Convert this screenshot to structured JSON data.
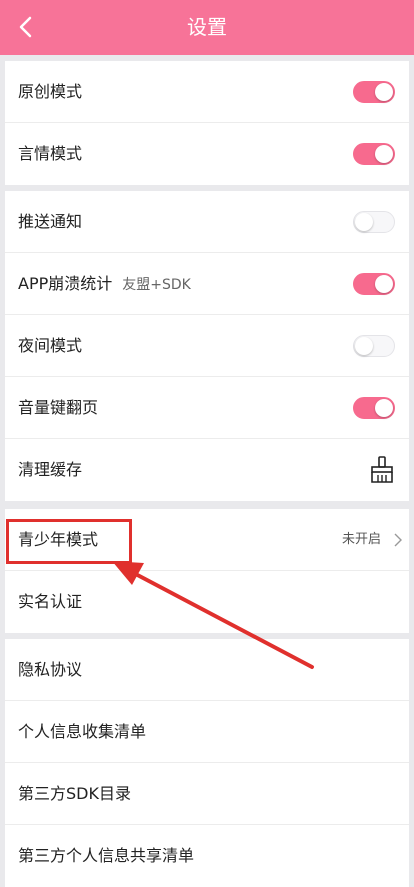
{
  "header": {
    "title": "设置",
    "back_icon": "chevron-left-icon"
  },
  "group1": [
    {
      "label": "原创模式",
      "toggle": true
    },
    {
      "label": "言情模式",
      "toggle": true
    }
  ],
  "group2": [
    {
      "label": "推送通知",
      "toggle": false
    },
    {
      "label": "APP崩溃统计",
      "sublabel": "友盟+SDK",
      "toggle": true
    },
    {
      "label": "夜间模式",
      "toggle": false
    },
    {
      "label": "音量键翻页",
      "toggle": true
    },
    {
      "label": "清理缓存",
      "icon": "broom-icon"
    }
  ],
  "group3": [
    {
      "label": "青少年模式",
      "status": "未开启",
      "icon": "chevron-right-icon"
    },
    {
      "label": "实名认证"
    }
  ],
  "group4": [
    {
      "label": "隐私协议"
    },
    {
      "label": "个人信息收集清单"
    },
    {
      "label": "第三方SDK目录"
    },
    {
      "label": "第三方个人信息共享清单"
    }
  ],
  "colors": {
    "accent": "#f77398",
    "toggle_on": "#f76a8e",
    "annotation": "#e0302d"
  }
}
